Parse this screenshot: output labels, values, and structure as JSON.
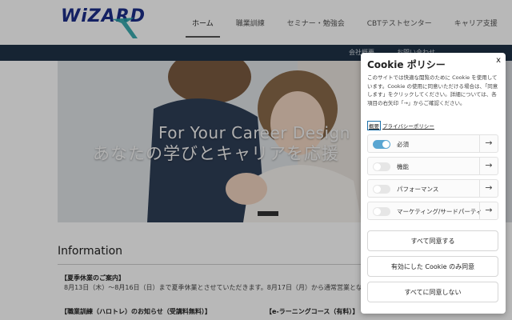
{
  "header": {
    "logo_text": "WiZARD",
    "nav": [
      {
        "label": "ホーム"
      },
      {
        "label": "職業訓練"
      },
      {
        "label": "セミナー・勉強会"
      },
      {
        "label": "CBTテストセンター"
      },
      {
        "label": "キャリア支援"
      }
    ],
    "subnav": [
      {
        "label": "会社概要"
      },
      {
        "label": "お問い合わせ"
      }
    ]
  },
  "hero": {
    "line1": "For Your Career Design",
    "line2": "あなたの学びとキャリアを応援"
  },
  "info": {
    "title": "Information",
    "notice1_title": "【夏季休業のご案内】",
    "notice1_body": "8月13日（木）〜8月16日（日）まで夏季休業とさせていただきます。8月17日（月）から通常営業とな",
    "notice2_title": "【職業訓練（ハロトレ）のお知らせ（受講料無料）】",
    "notice3_title": "【e-ラーニングコース（有料）】"
  },
  "cookie": {
    "title": "Cookie ポリシー",
    "close": "x",
    "description": "このサイトでは快適な閲覧のために Cookie を使用しています。Cookie の使用に同意いただける場合は、「同意します」をクリックしてください。詳細については、各項目の右矢印「→」からご確認ください。",
    "summary_link": "概要",
    "privacy_link": "プライバシーポリシー",
    "categories": [
      {
        "label": "必須",
        "enabled": true
      },
      {
        "label": "機能",
        "enabled": false
      },
      {
        "label": "パフォーマンス",
        "enabled": false
      },
      {
        "label": "マーケティング/サードパーティ",
        "enabled": false
      }
    ],
    "buttons": {
      "accept_all": "すべて同意する",
      "accept_enabled": "有効にした Cookie のみ同意",
      "reject_all": "すべてに同意しない"
    }
  },
  "colors": {
    "brand_navy": "#1c2f8a",
    "toggle_on": "#5aa6d2",
    "subbar": "#1f3347"
  }
}
